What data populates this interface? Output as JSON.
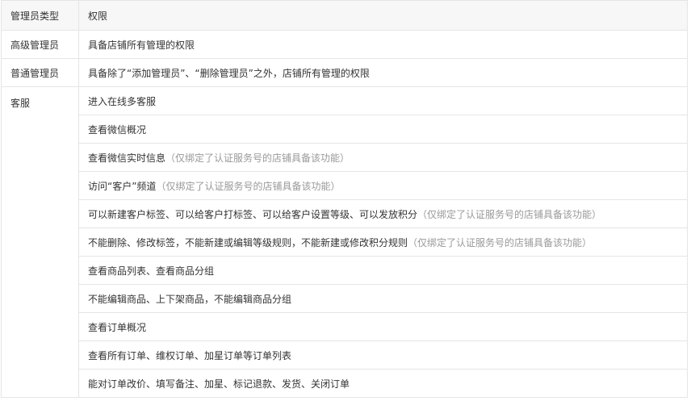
{
  "table": {
    "headers": [
      "管理员类型",
      "权限"
    ],
    "rows": [
      {
        "role": "高级管理员",
        "permissions": [
          {
            "text": "具备店铺所有管理的权限",
            "note": ""
          }
        ]
      },
      {
        "role": "普通管理员",
        "permissions": [
          {
            "text": "具备除了“添加管理员”、“删除管理员”之外，店铺所有管理的权限",
            "note": ""
          }
        ]
      },
      {
        "role": "客服",
        "permissions": [
          {
            "text": "进入在线多客服",
            "note": ""
          },
          {
            "text": "查看微信概况",
            "note": ""
          },
          {
            "text": "查看微信实时信息",
            "note": "（仅绑定了认证服务号的店铺具备该功能）"
          },
          {
            "text": "访问“客户”频道",
            "note": "（仅绑定了认证服务号的店铺具备该功能）"
          },
          {
            "text": "可以新建客户标签、可以给客户打标签、可以给客户设置等级、可以发放积分",
            "note": "（仅绑定了认证服务号的店铺具备该功能）"
          },
          {
            "text": "不能删除、修改标签，不能新建或编辑等级规则，不能新建或修改积分规则",
            "note": "（仅绑定了认证服务号的店铺具备该功能）"
          },
          {
            "text": "查看商品列表、查看商品分组",
            "note": ""
          },
          {
            "text": "不能编辑商品、上下架商品，不能编辑商品分组",
            "note": ""
          },
          {
            "text": "查看订单概况",
            "note": ""
          },
          {
            "text": "查看所有订单、维权订单、加星订单等订单列表",
            "note": ""
          },
          {
            "text": "能对订单改价、填写备注、加星、标记退款、发货、关闭订单",
            "note": ""
          }
        ]
      }
    ]
  }
}
